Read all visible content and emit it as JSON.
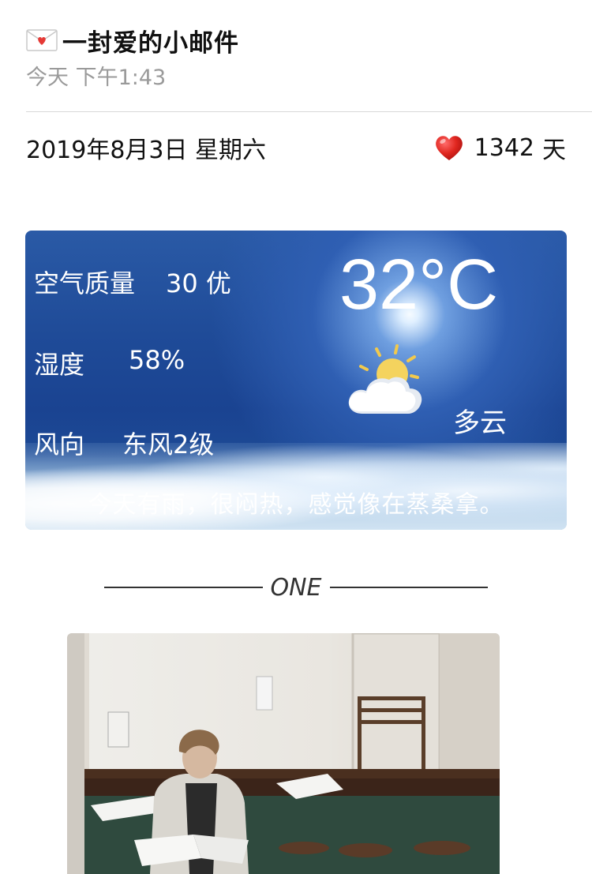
{
  "header": {
    "envelope_icon": "love-letter-icon",
    "title": "一封爱的小邮件",
    "time": "今天 下午1:43"
  },
  "date_row": {
    "date": "2019年8月3日 星期六",
    "heart_icon": "heart-icon",
    "days": "1342",
    "days_unit": "天"
  },
  "weather": {
    "air_quality_label": "空气质量",
    "air_quality_value": "30 优",
    "humidity_label": "湿度",
    "humidity_value": "58%",
    "wind_label": "风向",
    "wind_value": "东风2级",
    "temperature": "32°C",
    "condition_icon": "partly-cloudy-icon",
    "condition": "多云",
    "remark": "今天有雨，很闷热，感觉像在蒸桑拿。"
  },
  "section": {
    "title": "ONE"
  },
  "photo": {
    "subject": "man-reading-newspaper-photo"
  }
}
